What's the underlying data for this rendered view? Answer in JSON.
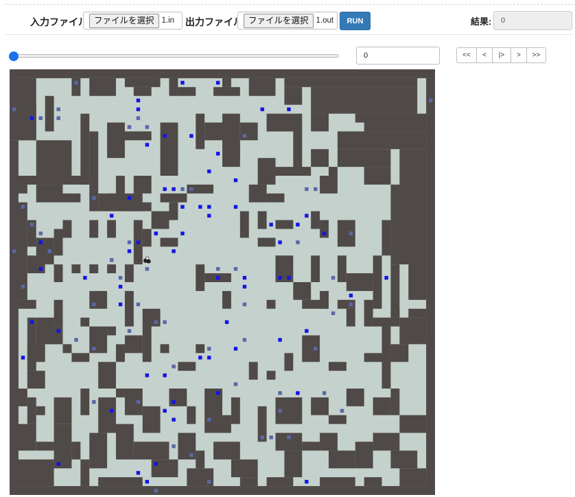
{
  "header": {
    "input_label": "入力ファイル",
    "input_button": "ファイルを選択",
    "input_filename": "1.in",
    "output_label": "出力ファイル",
    "output_button": "ファイルを選択",
    "output_filename": "1.out",
    "run_label": "RUN",
    "result_label": "結果:",
    "result_value": "0"
  },
  "controls": {
    "slider_progress": 0,
    "turn_value": "0",
    "nav_buttons": [
      "<<",
      "<",
      "|>",
      ">",
      ">>"
    ]
  },
  "colors": {
    "wall": "#4f4a47",
    "floor": "#c5d1cc",
    "blue_item": "#1414e8",
    "gray_item": "#5a67a8",
    "accent": "#337ab7",
    "slider": "#1a73e8"
  },
  "grid": {
    "cols": 48,
    "rows": 48,
    "wall_rects": [
      [
        0,
        0,
        48,
        1
      ],
      [
        0,
        1,
        3,
        7
      ],
      [
        7,
        1,
        1,
        2
      ],
      [
        9,
        1,
        3,
        2
      ],
      [
        13,
        1,
        4,
        1
      ],
      [
        14,
        2,
        2,
        1
      ],
      [
        18,
        1,
        1,
        2
      ],
      [
        19,
        2,
        2,
        1
      ],
      [
        24,
        1,
        1,
        1
      ],
      [
        23,
        2,
        3,
        1
      ],
      [
        27,
        1,
        3,
        2
      ],
      [
        31,
        1,
        15,
        1
      ],
      [
        31,
        2,
        2,
        2
      ],
      [
        34,
        2,
        12,
        3
      ],
      [
        47,
        1,
        1,
        47
      ],
      [
        0,
        8,
        1,
        40
      ],
      [
        3,
        8,
        4,
        4
      ],
      [
        8,
        5,
        1,
        8
      ],
      [
        9,
        7,
        1,
        9
      ],
      [
        11,
        6,
        2,
        4
      ],
      [
        12,
        7,
        4,
        1
      ],
      [
        17,
        6,
        2,
        6
      ],
      [
        21,
        5,
        1,
        4
      ],
      [
        22,
        6,
        2,
        2
      ],
      [
        24,
        5,
        2,
        6
      ],
      [
        26,
        6,
        2,
        2
      ],
      [
        29,
        5,
        4,
        2
      ],
      [
        32,
        6,
        1,
        6
      ],
      [
        34,
        5,
        2,
        2
      ],
      [
        39,
        5,
        8,
        1
      ],
      [
        40,
        6,
        7,
        1
      ],
      [
        37,
        7,
        10,
        2
      ],
      [
        37,
        9,
        6,
        2
      ],
      [
        40,
        11,
        3,
        2
      ],
      [
        44,
        9,
        3,
        5
      ],
      [
        43,
        13,
        4,
        9
      ],
      [
        1,
        4,
        2,
        4
      ],
      [
        4,
        3,
        1,
        4
      ],
      [
        0,
        12,
        9,
        1
      ],
      [
        0,
        13,
        2,
        1
      ],
      [
        3,
        13,
        3,
        2
      ],
      [
        6,
        14,
        2,
        1
      ],
      [
        0,
        15,
        2,
        9
      ],
      [
        2,
        17,
        1,
        3
      ],
      [
        0,
        24,
        2,
        2
      ],
      [
        10,
        14,
        5,
        2
      ],
      [
        13,
        15,
        3,
        1
      ],
      [
        28,
        10,
        2,
        3
      ],
      [
        30,
        11,
        4,
        1
      ],
      [
        34,
        9,
        2,
        2
      ],
      [
        35,
        12,
        1,
        2
      ],
      [
        36,
        11,
        1,
        3
      ],
      [
        29,
        6,
        3,
        1
      ],
      [
        25,
        8,
        1,
        2
      ],
      [
        11,
        14,
        2,
        1
      ],
      [
        12,
        12,
        1,
        2
      ],
      [
        14,
        12,
        2,
        2
      ],
      [
        17,
        14,
        3,
        1
      ],
      [
        18,
        15,
        1,
        2
      ],
      [
        20,
        13,
        3,
        1
      ],
      [
        27,
        13,
        2,
        2
      ],
      [
        29,
        14,
        2,
        1
      ],
      [
        26,
        16,
        1,
        3
      ],
      [
        28,
        16,
        1,
        2
      ],
      [
        30,
        17,
        2,
        1
      ],
      [
        34,
        16,
        1,
        2
      ],
      [
        35,
        17,
        1,
        2
      ],
      [
        37,
        17,
        2,
        3
      ],
      [
        42,
        17,
        1,
        4
      ],
      [
        44,
        16,
        1,
        2
      ],
      [
        6,
        17,
        1,
        2
      ],
      [
        9,
        17,
        1,
        2
      ],
      [
        11,
        17,
        1,
        2
      ],
      [
        14,
        17,
        1,
        5
      ],
      [
        15,
        18,
        1,
        2
      ],
      [
        16,
        16,
        2,
        2
      ],
      [
        17,
        19,
        2,
        1
      ],
      [
        28,
        19,
        2,
        1
      ],
      [
        3,
        19,
        2,
        3
      ],
      [
        5,
        18,
        1,
        3
      ],
      [
        2,
        21,
        2,
        2
      ],
      [
        5,
        22,
        1,
        2
      ],
      [
        7,
        22,
        1,
        1
      ],
      [
        9,
        22,
        1,
        1
      ],
      [
        11,
        22,
        1,
        1
      ],
      [
        13,
        22,
        1,
        2
      ],
      [
        30,
        21,
        2,
        3
      ],
      [
        34,
        21,
        1,
        3
      ],
      [
        37,
        21,
        1,
        3
      ],
      [
        41,
        21,
        1,
        6
      ],
      [
        45,
        21,
        2,
        5
      ],
      [
        43,
        22,
        1,
        6
      ],
      [
        0,
        26,
        3,
        1
      ],
      [
        2,
        28,
        1,
        6
      ],
      [
        3,
        28,
        2,
        3
      ],
      [
        5,
        26,
        1,
        3
      ],
      [
        8,
        28,
        1,
        1
      ],
      [
        9,
        25,
        2,
        2
      ],
      [
        13,
        25,
        1,
        4
      ],
      [
        15,
        27,
        2,
        2
      ],
      [
        21,
        22,
        1,
        3
      ],
      [
        22,
        23,
        3,
        1
      ],
      [
        24,
        25,
        1,
        2
      ],
      [
        29,
        26,
        1,
        1
      ],
      [
        32,
        24,
        2,
        2
      ],
      [
        33,
        26,
        3,
        1
      ],
      [
        35,
        25,
        1,
        2
      ],
      [
        38,
        23,
        3,
        2
      ],
      [
        37,
        26,
        2,
        1
      ],
      [
        38,
        27,
        1,
        2
      ],
      [
        40,
        26,
        1,
        3
      ],
      [
        41,
        28,
        3,
        1
      ],
      [
        43,
        27,
        1,
        1
      ],
      [
        45,
        27,
        2,
        1
      ],
      [
        44,
        28,
        3,
        3
      ],
      [
        0,
        34,
        1,
        2
      ],
      [
        2,
        31,
        2,
        2
      ],
      [
        2,
        34,
        2,
        2
      ],
      [
        4,
        29,
        2,
        2
      ],
      [
        6,
        31,
        1,
        1
      ],
      [
        7,
        32,
        2,
        1
      ],
      [
        9,
        29,
        2,
        3
      ],
      [
        11,
        29,
        1,
        1
      ],
      [
        10,
        33,
        2,
        3
      ],
      [
        12,
        31,
        1,
        2
      ],
      [
        13,
        30,
        2,
        2
      ],
      [
        15,
        29,
        1,
        4
      ],
      [
        17,
        31,
        1,
        1
      ],
      [
        19,
        33,
        2,
        1
      ],
      [
        21,
        31,
        1,
        1
      ],
      [
        27,
        33,
        1,
        2
      ],
      [
        29,
        34,
        1,
        1
      ],
      [
        31,
        32,
        1,
        2
      ],
      [
        33,
        30,
        2,
        3
      ],
      [
        36,
        33,
        2,
        1
      ],
      [
        40,
        32,
        2,
        1
      ],
      [
        42,
        29,
        1,
        7
      ],
      [
        43,
        31,
        2,
        2
      ],
      [
        0,
        36,
        2,
        2
      ],
      [
        2,
        37,
        1,
        3
      ],
      [
        3,
        38,
        1,
        1
      ],
      [
        5,
        37,
        2,
        3
      ],
      [
        8,
        36,
        1,
        3
      ],
      [
        10,
        37,
        2,
        4
      ],
      [
        12,
        36,
        1,
        1
      ],
      [
        13,
        36,
        2,
        3
      ],
      [
        15,
        38,
        2,
        3
      ],
      [
        18,
        36,
        2,
        2
      ],
      [
        20,
        38,
        1,
        2
      ],
      [
        22,
        36,
        2,
        5
      ],
      [
        24,
        39,
        1,
        2
      ],
      [
        25,
        37,
        1,
        3
      ],
      [
        28,
        38,
        1,
        4
      ],
      [
        30,
        37,
        3,
        3
      ],
      [
        34,
        37,
        2,
        2
      ],
      [
        36,
        39,
        2,
        1
      ],
      [
        38,
        36,
        2,
        2
      ],
      [
        41,
        37,
        2,
        2
      ],
      [
        43,
        36,
        1,
        3
      ],
      [
        44,
        39,
        3,
        2
      ],
      [
        0,
        40,
        3,
        3
      ],
      [
        3,
        42,
        2,
        1
      ],
      [
        5,
        40,
        2,
        5
      ],
      [
        7,
        42,
        1,
        2
      ],
      [
        9,
        41,
        2,
        4
      ],
      [
        12,
        40,
        2,
        4
      ],
      [
        14,
        42,
        4,
        2
      ],
      [
        16,
        44,
        3,
        2
      ],
      [
        19,
        41,
        2,
        3
      ],
      [
        21,
        43,
        1,
        2
      ],
      [
        23,
        42,
        3,
        2
      ],
      [
        25,
        44,
        3,
        2
      ],
      [
        26,
        46,
        2,
        1
      ],
      [
        30,
        41,
        3,
        2
      ],
      [
        31,
        43,
        2,
        3
      ],
      [
        33,
        42,
        2,
        1
      ],
      [
        35,
        41,
        2,
        2
      ],
      [
        36,
        43,
        3,
        2
      ],
      [
        39,
        42,
        2,
        3
      ],
      [
        41,
        41,
        3,
        2
      ],
      [
        43,
        43,
        3,
        2
      ],
      [
        44,
        45,
        3,
        2
      ],
      [
        0,
        44,
        5,
        3
      ],
      [
        0,
        47,
        48,
        1
      ],
      [
        8,
        44,
        1,
        3
      ],
      [
        10,
        46,
        5,
        1
      ],
      [
        20,
        45,
        3,
        2
      ],
      [
        29,
        46,
        3,
        1
      ],
      [
        35,
        46,
        4,
        1
      ],
      [
        40,
        46,
        2,
        1
      ]
    ],
    "blue_items": [
      [
        19,
        1
      ],
      [
        23,
        1
      ],
      [
        14,
        4
      ],
      [
        28,
        4
      ],
      [
        31,
        4
      ],
      [
        14,
        3
      ],
      [
        2,
        5
      ],
      [
        17,
        7
      ],
      [
        20,
        7
      ],
      [
        15,
        8
      ],
      [
        23,
        9
      ],
      [
        22,
        11
      ],
      [
        25,
        12
      ],
      [
        17,
        13
      ],
      [
        18,
        13
      ],
      [
        19,
        15
      ],
      [
        21,
        15
      ],
      [
        22,
        15
      ],
      [
        25,
        15
      ],
      [
        11,
        16
      ],
      [
        22,
        16
      ],
      [
        33,
        16
      ],
      [
        16,
        18
      ],
      [
        19,
        18
      ],
      [
        29,
        17
      ],
      [
        3,
        19
      ],
      [
        14,
        19
      ],
      [
        30,
        19
      ],
      [
        13,
        20
      ],
      [
        18,
        20
      ],
      [
        26,
        23
      ],
      [
        30,
        23
      ],
      [
        3,
        22
      ],
      [
        8,
        23
      ],
      [
        23,
        23
      ],
      [
        26,
        24
      ],
      [
        42,
        23
      ],
      [
        12,
        24
      ],
      [
        12,
        26
      ],
      [
        38,
        25
      ],
      [
        2,
        28
      ],
      [
        24,
        28
      ],
      [
        5,
        29
      ],
      [
        30,
        30
      ],
      [
        25,
        31
      ],
      [
        15,
        34
      ],
      [
        1,
        32
      ],
      [
        22,
        32
      ],
      [
        17,
        34
      ],
      [
        21,
        32
      ],
      [
        23,
        36
      ],
      [
        18,
        37
      ],
      [
        17,
        38
      ],
      [
        18,
        39
      ],
      [
        32,
        36
      ],
      [
        11,
        38
      ],
      [
        5,
        44
      ],
      [
        14,
        45
      ],
      [
        16,
        44
      ],
      [
        15,
        46
      ],
      [
        33,
        46
      ],
      [
        13,
        14
      ],
      [
        35,
        18
      ],
      [
        32,
        17
      ],
      [
        31,
        23
      ],
      [
        33,
        29
      ]
    ],
    "gray_items": [
      [
        7,
        1
      ],
      [
        47,
        3
      ],
      [
        0,
        4
      ],
      [
        5,
        5
      ],
      [
        3,
        5
      ],
      [
        5,
        4
      ],
      [
        14,
        5
      ],
      [
        15,
        6
      ],
      [
        13,
        6
      ],
      [
        26,
        7
      ],
      [
        19,
        13
      ],
      [
        20,
        13
      ],
      [
        33,
        13
      ],
      [
        34,
        13
      ],
      [
        3,
        18
      ],
      [
        2,
        17
      ],
      [
        1,
        15
      ],
      [
        0,
        20
      ],
      [
        4,
        20
      ],
      [
        9,
        14
      ],
      [
        13,
        19
      ],
      [
        11,
        21
      ],
      [
        15,
        22
      ],
      [
        25,
        22
      ],
      [
        23,
        22
      ],
      [
        32,
        19
      ],
      [
        38,
        18
      ],
      [
        12,
        23
      ],
      [
        14,
        26
      ],
      [
        9,
        26
      ],
      [
        13,
        29
      ],
      [
        16,
        28
      ],
      [
        17,
        28
      ],
      [
        26,
        30
      ],
      [
        22,
        31
      ],
      [
        34,
        31
      ],
      [
        26,
        26
      ],
      [
        25,
        35
      ],
      [
        18,
        33
      ],
      [
        9,
        31
      ],
      [
        7,
        30
      ],
      [
        1,
        24
      ],
      [
        9,
        37
      ],
      [
        30,
        36
      ],
      [
        31,
        41
      ],
      [
        22,
        39
      ],
      [
        28,
        41
      ],
      [
        29,
        41
      ],
      [
        20,
        43
      ],
      [
        30,
        38
      ],
      [
        37,
        38
      ],
      [
        35,
        36
      ],
      [
        36,
        27
      ],
      [
        36,
        23
      ],
      [
        38,
        26
      ],
      [
        14,
        37
      ],
      [
        18,
        42
      ],
      [
        16,
        47
      ],
      [
        22,
        46
      ]
    ]
  },
  "piece_icon": "player-piece"
}
